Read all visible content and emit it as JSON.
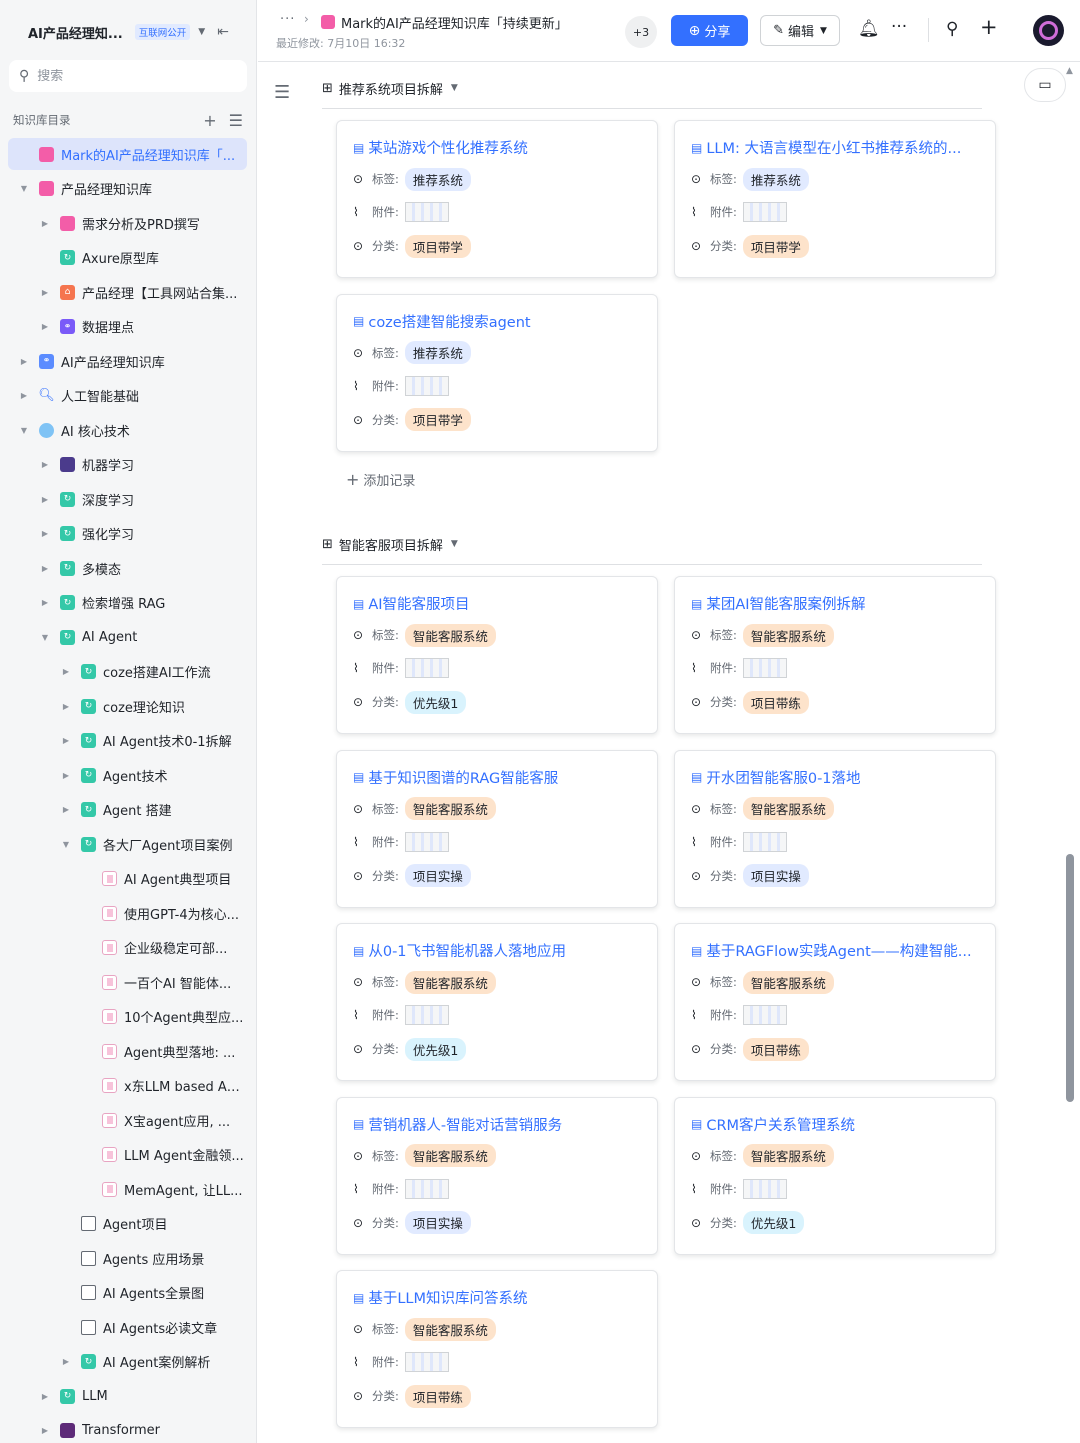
{
  "sidebar": {
    "title": "AI产品经理知...",
    "badge": "互联网公开",
    "search_placeholder": "搜索",
    "directory_label": "知识库目录",
    "items": [
      {
        "label": "Mark的AI产品经理知识库「...",
        "depth": 0,
        "arrow": "",
        "icon": "pink",
        "active": true
      },
      {
        "label": "产品经理知识库",
        "depth": 0,
        "arrow": "down",
        "icon": "pink"
      },
      {
        "label": "需求分析及PRD撰写",
        "depth": 1,
        "arrow": "right",
        "icon": "pink"
      },
      {
        "label": "Axure原型库",
        "depth": 1,
        "arrow": "",
        "icon": "green"
      },
      {
        "label": "产品经理【工具网站合集...",
        "depth": 1,
        "arrow": "right",
        "icon": "orange"
      },
      {
        "label": "数据埋点",
        "depth": 1,
        "arrow": "right",
        "icon": "purple"
      },
      {
        "label": "AI产品经理知识库",
        "depth": 0,
        "arrow": "right",
        "icon": "blue"
      },
      {
        "label": "人工智能基础",
        "depth": 0,
        "arrow": "right",
        "icon": "mag"
      },
      {
        "label": "AI 核心技术",
        "depth": 0,
        "arrow": "down",
        "icon": "sky"
      },
      {
        "label": "机器学习",
        "depth": 1,
        "arrow": "right",
        "icon": "robot"
      },
      {
        "label": "深度学习",
        "depth": 1,
        "arrow": "right",
        "icon": "green"
      },
      {
        "label": "强化学习",
        "depth": 1,
        "arrow": "right",
        "icon": "green"
      },
      {
        "label": "多模态",
        "depth": 1,
        "arrow": "right",
        "icon": "green"
      },
      {
        "label": "检索增强 RAG",
        "depth": 1,
        "arrow": "right",
        "icon": "green"
      },
      {
        "label": "AI Agent",
        "depth": 1,
        "arrow": "down",
        "icon": "green"
      },
      {
        "label": "coze搭建AI工作流",
        "depth": 2,
        "arrow": "right",
        "icon": "green"
      },
      {
        "label": "coze理论知识",
        "depth": 2,
        "arrow": "right",
        "icon": "green"
      },
      {
        "label": "AI Agent技术0-1拆解",
        "depth": 2,
        "arrow": "right",
        "icon": "green"
      },
      {
        "label": "Agent技术",
        "depth": 2,
        "arrow": "right",
        "icon": "green"
      },
      {
        "label": "Agent 搭建",
        "depth": 2,
        "arrow": "right",
        "icon": "green"
      },
      {
        "label": "各大厂Agent项目案例",
        "depth": 2,
        "arrow": "down",
        "icon": "green"
      },
      {
        "label": "AI Agent典型项目",
        "depth": 3,
        "arrow": "",
        "icon": "doc"
      },
      {
        "label": "使用GPT-4为核心...",
        "depth": 3,
        "arrow": "",
        "icon": "doc"
      },
      {
        "label": "企业级稳定可部...",
        "depth": 3,
        "arrow": "",
        "icon": "doc"
      },
      {
        "label": "一百个AI 智能体...",
        "depth": 3,
        "arrow": "",
        "icon": "doc"
      },
      {
        "label": "10个Agent典型应...",
        "depth": 3,
        "arrow": "",
        "icon": "doc"
      },
      {
        "label": "Agent典型落地: ...",
        "depth": 3,
        "arrow": "",
        "icon": "doc"
      },
      {
        "label": "x东LLM based Ag...",
        "depth": 3,
        "arrow": "",
        "icon": "doc"
      },
      {
        "label": "X宝agent应用, ...",
        "depth": 3,
        "arrow": "",
        "icon": "doc"
      },
      {
        "label": "LLM Agent金融领...",
        "depth": 3,
        "arrow": "",
        "icon": "doc"
      },
      {
        "label": "MemAgent, 让LL...",
        "depth": 3,
        "arrow": "",
        "icon": "doc"
      },
      {
        "label": "Agent项目",
        "depth": 2,
        "arrow": "",
        "icon": "table"
      },
      {
        "label": "Agents 应用场景",
        "depth": 2,
        "arrow": "",
        "icon": "table"
      },
      {
        "label": "AI Agents全景图",
        "depth": 2,
        "arrow": "",
        "icon": "table"
      },
      {
        "label": "AI Agents必读文章",
        "depth": 2,
        "arrow": "",
        "icon": "table"
      },
      {
        "label": "AI Agent案例解析",
        "depth": 2,
        "arrow": "right",
        "icon": "green"
      },
      {
        "label": "LLM",
        "depth": 1,
        "arrow": "right",
        "icon": "green"
      },
      {
        "label": "Transformer",
        "depth": 1,
        "arrow": "right",
        "icon": "dark"
      }
    ]
  },
  "header": {
    "breadcrumb_dots": "···",
    "title": "Mark的AI产品经理知识库「持续更新」",
    "last_modified": "最近修改: 7月10日 16:32",
    "collaborators": "+3",
    "share_label": "分享",
    "edit_label": "编辑"
  },
  "field_labels": {
    "tag": "标签:",
    "attachment": "附件:",
    "category": "分类:"
  },
  "add_record": "添加记录",
  "groups": [
    {
      "title": "推荐系统项目拆解",
      "cards": [
        {
          "title": "某站游戏个性化推荐系统",
          "tag": "推荐系统",
          "category": "项目带学",
          "tag_color": "blue",
          "cat_color": "orange"
        },
        {
          "title": "LLM: 大语言模型在小红书推荐系统的...",
          "tag": "推荐系统",
          "category": "项目带学",
          "tag_color": "blue",
          "cat_color": "orange"
        },
        {
          "title": "coze搭建智能搜索agent",
          "tag": "推荐系统",
          "category": "项目带学",
          "tag_color": "blue",
          "cat_color": "orange"
        }
      ]
    },
    {
      "title": "智能客服项目拆解",
      "cards": [
        {
          "title": "AI智能客服项目",
          "tag": "智能客服系统",
          "category": "优先级1",
          "tag_color": "orange",
          "cat_color": "cyan"
        },
        {
          "title": "某团AI智能客服案例拆解",
          "tag": "智能客服系统",
          "category": "项目带练",
          "tag_color": "orange",
          "cat_color": "orange"
        },
        {
          "title": "基于知识图谱的RAG智能客服",
          "tag": "智能客服系统",
          "category": "项目实操",
          "tag_color": "orange",
          "cat_color": "blue"
        },
        {
          "title": "开水团智能客服0-1落地",
          "tag": "智能客服系统",
          "category": "项目实操",
          "tag_color": "orange",
          "cat_color": "blue"
        },
        {
          "title": "从0-1飞书智能机器人落地应用",
          "tag": "智能客服系统",
          "category": "优先级1",
          "tag_color": "orange",
          "cat_color": "cyan"
        },
        {
          "title": "基于RAGFlow实践Agent——构建智能...",
          "tag": "智能客服系统",
          "category": "项目带练",
          "tag_color": "orange",
          "cat_color": "orange"
        },
        {
          "title": "营销机器人-智能对话营销服务",
          "tag": "智能客服系统",
          "category": "项目实操",
          "tag_color": "orange",
          "cat_color": "blue"
        },
        {
          "title": "CRM客户关系管理系统",
          "tag": "智能客服系统",
          "category": "优先级1",
          "tag_color": "orange",
          "cat_color": "cyan"
        },
        {
          "title": "基于LLM知识库问答系统",
          "tag": "智能客服系统",
          "category": "项目带练",
          "tag_color": "orange",
          "cat_color": "orange"
        }
      ]
    }
  ]
}
